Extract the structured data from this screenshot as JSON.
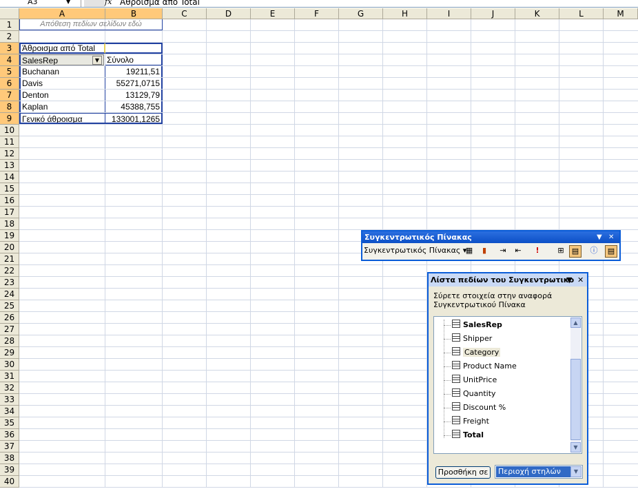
{
  "formula_bar": {
    "name_box": "A3",
    "fx": "fx",
    "formula": "Άθροισμα από Total"
  },
  "columns": [
    "A",
    "B",
    "C",
    "D",
    "E",
    "F",
    "G",
    "H",
    "I",
    "J",
    "K",
    "L",
    "M"
  ],
  "rows": [
    "1",
    "2",
    "3",
    "4",
    "5",
    "6",
    "7",
    "8",
    "9",
    "10",
    "11",
    "12",
    "13",
    "14",
    "15",
    "16",
    "17",
    "18",
    "19",
    "20",
    "21",
    "22",
    "23",
    "24",
    "25",
    "26",
    "27",
    "28",
    "29",
    "30",
    "31",
    "32",
    "33",
    "34",
    "35",
    "36",
    "37",
    "38",
    "39",
    "40"
  ],
  "pivot": {
    "page_drop": "Απόθεση πεδίων σελίδων εδώ",
    "data_field": "Άθροισμα από Total",
    "row_field": "SalesRep",
    "total_header": "Σύνολο",
    "items": [
      {
        "name": "Buchanan",
        "value": "19211,51"
      },
      {
        "name": "Davis",
        "value": "55271,0715"
      },
      {
        "name": "Denton",
        "value": "13129,79"
      },
      {
        "name": "Kaplan",
        "value": "45388,755"
      }
    ],
    "grand_total_label": "Γενικό άθροισμα",
    "grand_total_value": "133001,1265"
  },
  "pivot_toolbar": {
    "title": "Συγκεντρωτικός Πίνακας",
    "menu_label": "Συγκεντρωτικός Πίνακας"
  },
  "field_list": {
    "title": "Λίστα πεδίων του Συγκεντρωτικο",
    "instructions_line1": "Σύρετε στοιχεία στην αναφορά",
    "instructions_line2": "Συγκεντρωτικού Πίνακα",
    "fields": [
      {
        "label": "SalesRep",
        "bold": true
      },
      {
        "label": "Shipper",
        "bold": false
      },
      {
        "label": "Category",
        "bold": false
      },
      {
        "label": "Product Name",
        "bold": false
      },
      {
        "label": "UnitPrice",
        "bold": false
      },
      {
        "label": "Quantity",
        "bold": false
      },
      {
        "label": "Discount %",
        "bold": false
      },
      {
        "label": "Freight",
        "bold": false
      },
      {
        "label": "Total",
        "bold": true
      }
    ],
    "add_button": "Προσθήκη σε",
    "area_value": "Περιοχή στηλών"
  },
  "colors": {
    "selection_header": "#ffc97a",
    "pivot_border": "#2040a0",
    "titlebar": "#0a5cd8"
  }
}
